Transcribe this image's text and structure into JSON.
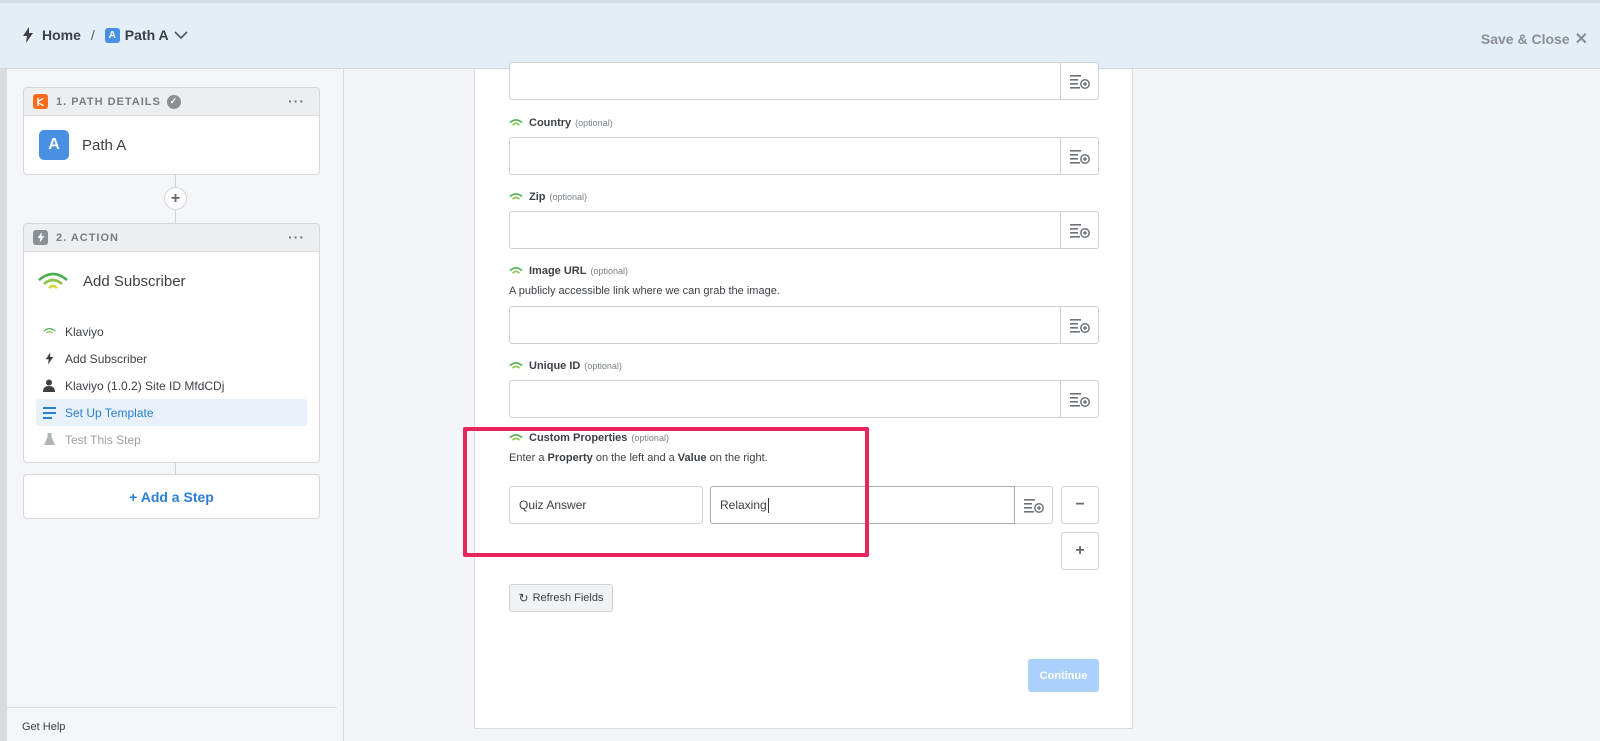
{
  "header": {
    "home_label": "Home",
    "separator": "/",
    "path_badge": "A",
    "path_label": "Path A",
    "save_close_label": "Save & Close",
    "close_glyph": "✕"
  },
  "sidebar": {
    "path_card": {
      "title": "1. PATH DETAILS",
      "menu": "···",
      "badge": "A",
      "name": "Path A"
    },
    "action_card": {
      "title": "2. ACTION",
      "menu": "···",
      "app_title": "Add Subscriber",
      "steps": [
        {
          "label": "Klaviyo",
          "icon": "klaviyo-icon"
        },
        {
          "label": "Add Subscriber",
          "icon": "bolt-icon"
        },
        {
          "label": "Klaviyo (1.0.2) Site ID MfdCDj",
          "icon": "user-icon"
        },
        {
          "label": "Set Up Template",
          "icon": "template-icon"
        },
        {
          "label": "Test This Step",
          "icon": "flask-icon"
        }
      ]
    },
    "add_step_label": "+ Add a Step",
    "get_help_label": "Get Help"
  },
  "form": {
    "fields": [
      {
        "label": "Country",
        "optional": "(optional)",
        "value": ""
      },
      {
        "label": "Zip",
        "optional": "(optional)",
        "value": ""
      },
      {
        "label": "Image URL",
        "optional": "(optional)",
        "help": "A publicly accessible link where we can grab the image.",
        "value": ""
      },
      {
        "label": "Unique ID",
        "optional": "(optional)",
        "value": ""
      }
    ],
    "custom_properties": {
      "label": "Custom Properties",
      "optional": "(optional)",
      "help_1": "Enter a ",
      "help_bold_1": "Property",
      "help_2": " on the left and a ",
      "help_bold_2": "Value",
      "help_3": " on the right.",
      "property_value": "Quiz Answer",
      "value_value": "Relaxing",
      "remove_glyph": "−",
      "add_glyph": "+"
    },
    "refresh_label": "Refresh Fields",
    "refresh_glyph": "↻",
    "continue_label": "Continue"
  },
  "colors": {
    "accent": "#2a7fd4",
    "highlight": "#e8245c",
    "klaviyo_green": "#4caf50",
    "path_orange": "#ff6a1a"
  }
}
